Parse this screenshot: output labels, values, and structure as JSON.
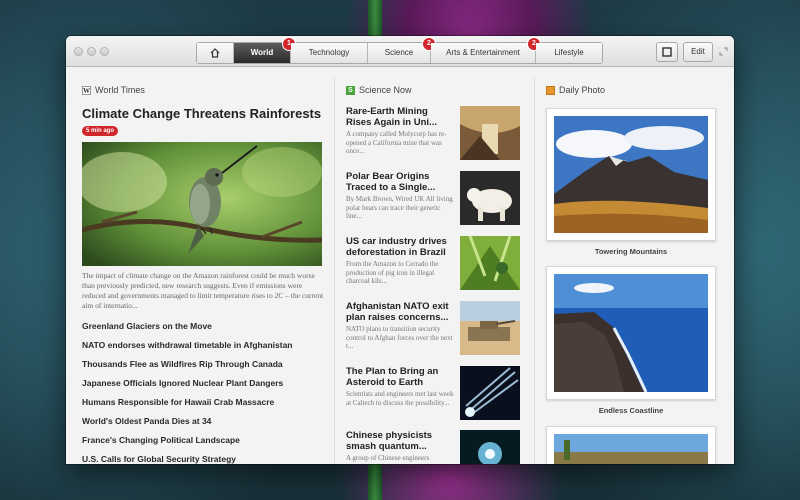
{
  "toolbar": {
    "tabs": [
      {
        "label": "World",
        "badge": "1"
      },
      {
        "label": "Technology",
        "badge": ""
      },
      {
        "label": "Science",
        "badge": "2"
      },
      {
        "label": "Arts & Entertainment",
        "badge": "2"
      },
      {
        "label": "Lifestyle",
        "badge": ""
      }
    ],
    "edit_label": "Edit",
    "home_icon": "home-icon",
    "layout_icon": "square-icon",
    "fullscreen_icon": "fullscreen-icon"
  },
  "world": {
    "source": "World Times",
    "source_icon": "W",
    "headline": "Climate Change Threatens Rainforests",
    "time_badge": "5 min ago",
    "summary": "The impact of climate change on the Amazon rainforest could be much worse than previously predicted, new research suggests. Even if emissions were reduced and governments managed to limit temperature rises to 2C – the current aim of internatio...",
    "headlines": [
      "Greenland Glaciers on the Move",
      "NATO endorses withdrawal timetable in Afghanistan",
      "Thousands Flee as Wildfires Rip Through Canada",
      "Japanese Officials Ignored Nuclear Plant Dangers",
      "Humans Responsible for Hawaii Crab Massacre",
      "World's Oldest Panda Dies at 34",
      "France's Changing Political Landscape",
      "U.S. Calls for Global Security Strategy"
    ]
  },
  "science": {
    "source": "Science Now",
    "source_icon": "S",
    "items": [
      {
        "title": "Rare-Earth Mining Rises Again in Uni...",
        "text": "A company called Molycorp has re-opened a California mine that was once..."
      },
      {
        "title": "Polar Bear Origins Traced to a Single...",
        "text": "By Mark Brown, Wired UK All living polar bears can trace their genetic line..."
      },
      {
        "title": "US car industry drives deforestation in Brazil",
        "text": "From the Amazon to Cerrado the production of pig iron in illegal charcoal kils..."
      },
      {
        "title": "Afghanistan NATO exit plan raises concerns...",
        "text": "NATO plans to transition security control to Afghan forces over the next t..."
      },
      {
        "title": "The Plan to Bring an Asteroid to Earth",
        "text": "Scientists and engineers met last week at Caltech to discuss the possibility..."
      },
      {
        "title": "Chinese physicists smash quantum...",
        "text": "A group of Chinese engineers"
      }
    ]
  },
  "photo": {
    "source": "Daily Photo",
    "captions": [
      "Towering Mountains",
      "Endless Coastline"
    ]
  },
  "colors": {
    "accent_red": "#d0262c",
    "science_green": "#4aa33a",
    "photo_orange": "#e8962e"
  }
}
